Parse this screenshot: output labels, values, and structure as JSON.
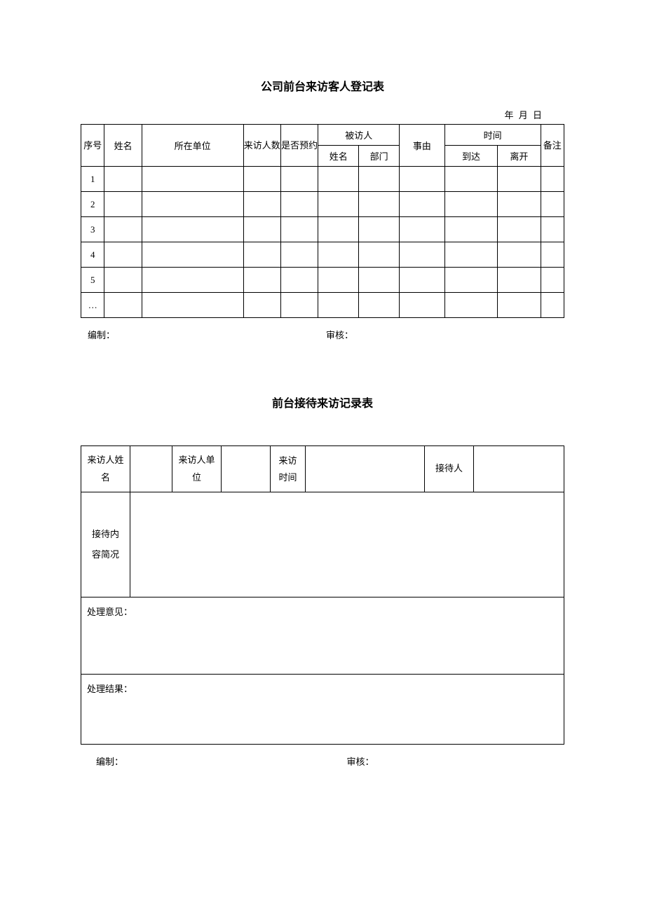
{
  "section1": {
    "title": "公司前台来访客人登记表",
    "date_line": "年  月  日",
    "headers": {
      "seq": "序号",
      "name": "姓名",
      "org": "所在单位",
      "visit_count": "来访人数",
      "appointment": "是否预约",
      "visited_group": "被访人",
      "visited_name": "姓名",
      "visited_dept": "部门",
      "reason": "事由",
      "time_group": "时间",
      "time_arrive": "到达",
      "time_leave": "离开",
      "remark": "备注"
    },
    "rows": [
      {
        "seq": "1",
        "name": "",
        "org": "",
        "visit_count": "",
        "appointment": "",
        "visited_name": "",
        "visited_dept": "",
        "reason": "",
        "time_arrive": "",
        "time_leave": "",
        "remark": ""
      },
      {
        "seq": "2",
        "name": "",
        "org": "",
        "visit_count": "",
        "appointment": "",
        "visited_name": "",
        "visited_dept": "",
        "reason": "",
        "time_arrive": "",
        "time_leave": "",
        "remark": ""
      },
      {
        "seq": "3",
        "name": "",
        "org": "",
        "visit_count": "",
        "appointment": "",
        "visited_name": "",
        "visited_dept": "",
        "reason": "",
        "time_arrive": "",
        "time_leave": "",
        "remark": ""
      },
      {
        "seq": "4",
        "name": "",
        "org": "",
        "visit_count": "",
        "appointment": "",
        "visited_name": "",
        "visited_dept": "",
        "reason": "",
        "time_arrive": "",
        "time_leave": "",
        "remark": ""
      },
      {
        "seq": "5",
        "name": "",
        "org": "",
        "visit_count": "",
        "appointment": "",
        "visited_name": "",
        "visited_dept": "",
        "reason": "",
        "time_arrive": "",
        "time_leave": "",
        "remark": ""
      },
      {
        "seq": "…",
        "name": "",
        "org": "",
        "visit_count": "",
        "appointment": "",
        "visited_name": "",
        "visited_dept": "",
        "reason": "",
        "time_arrive": "",
        "time_leave": "",
        "remark": ""
      }
    ],
    "footer": {
      "prepared": "编制：",
      "approved": "审核："
    }
  },
  "section2": {
    "title": "前台接待来访记录表",
    "labels": {
      "visitor_name": "来访人姓　名",
      "visitor_org": "来访人单　位",
      "visit_time": "来访时间",
      "receiver": "接待人",
      "content_summary": "接待内容简况",
      "opinion": "处理意见：",
      "result": "处理结果："
    },
    "values": {
      "visitor_name": "",
      "visitor_org": "",
      "visit_time": "",
      "receiver": "",
      "content_summary": "",
      "opinion": "",
      "result": ""
    },
    "footer": {
      "prepared": "编制：",
      "approved": "审核："
    }
  }
}
